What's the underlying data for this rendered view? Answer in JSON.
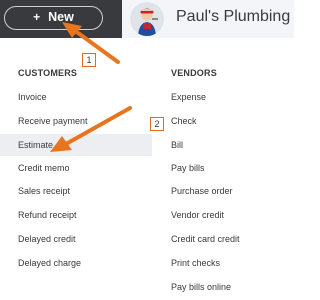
{
  "header": {
    "new_button": {
      "plus": "+",
      "label": "New"
    },
    "company_name": "Paul's Plumbing"
  },
  "menu": {
    "customers": {
      "title": "CUSTOMERS",
      "items": [
        "Invoice",
        "Receive payment",
        "Estimate",
        "Credit memo",
        "Sales receipt",
        "Refund receipt",
        "Delayed credit",
        "Delayed charge"
      ],
      "highlighted": "Estimate"
    },
    "vendors": {
      "title": "VENDORS",
      "items": [
        "Expense",
        "Check",
        "Bill",
        "Pay bills",
        "Purchase order",
        "Vendor credit",
        "Credit card credit",
        "Print checks",
        "Pay bills online"
      ]
    }
  },
  "annotations": {
    "step1": "1",
    "step2": "2"
  },
  "colors": {
    "topbar": "#393a3d",
    "arrow": "#e8741e",
    "highlight": "#eceef1",
    "text": "#393a3d"
  }
}
